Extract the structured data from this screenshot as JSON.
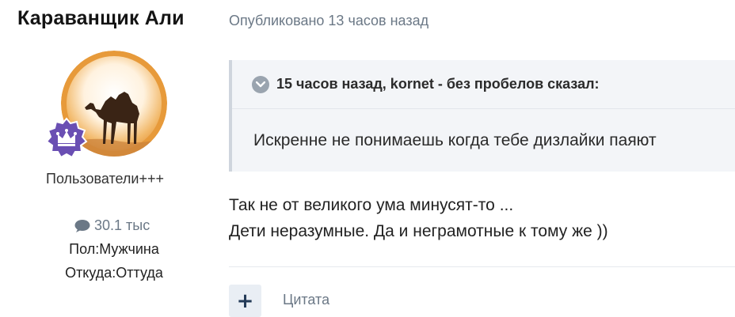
{
  "author": {
    "name": "Караванщик Али",
    "group": "Пользователи+++",
    "posts_count": "30.1 тыс",
    "gender": "Пол:Мужчина",
    "location": "Откуда:Оттуда",
    "icons": {
      "posts": "speech-bubble-icon",
      "rank": "crown-icon"
    }
  },
  "post": {
    "meta": "Опубликовано 13 часов назад",
    "quote": {
      "citation": "15 часов назад, kornet - без пробелов сказал:",
      "text": "Искренне не понимаешь когда тебе дизлайки паяют"
    },
    "lines": [
      "Так не от великого ума минусят-то ...",
      "Дети неразумные. Да и неграмотные к тому же ))"
    ]
  },
  "actions": {
    "add_label": "+",
    "quote_label": "Цитата"
  },
  "colors": {
    "accent": "#243b58",
    "muted": "#6b7886",
    "quote_bg": "#f3f5f8",
    "badge": "#6a4fb3"
  }
}
